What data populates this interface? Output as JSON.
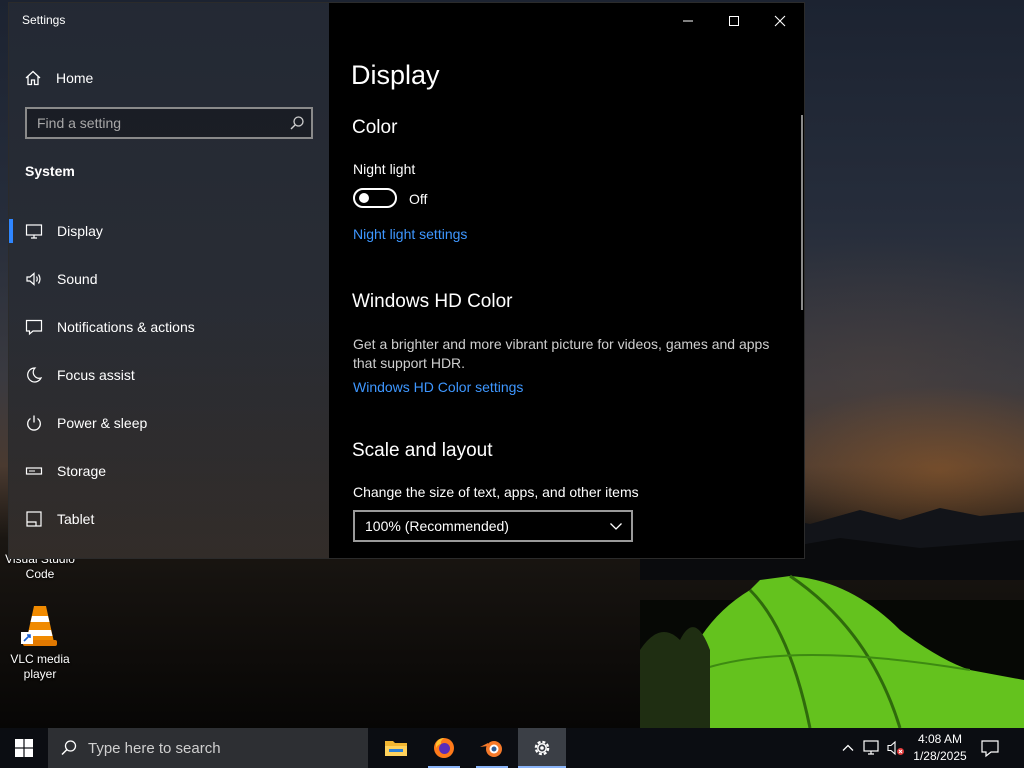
{
  "desktop": {
    "icons": [
      {
        "label": "Visual Studio Code",
        "icon": "vscode-icon"
      },
      {
        "label": "VLC media player",
        "icon": "vlc-cone-icon"
      }
    ]
  },
  "window": {
    "app_title": "Settings",
    "caption_buttons": [
      "minimize-icon",
      "maximize-icon",
      "close-icon"
    ]
  },
  "sidebar": {
    "home_label": "Home",
    "search_placeholder": "Find a setting",
    "section_heading": "System",
    "items": [
      {
        "label": "Display",
        "icon": "monitor-icon",
        "active": true
      },
      {
        "label": "Sound",
        "icon": "speaker-icon"
      },
      {
        "label": "Notifications & actions",
        "icon": "notification-icon"
      },
      {
        "label": "Focus assist",
        "icon": "moon-icon"
      },
      {
        "label": "Power & sleep",
        "icon": "power-icon"
      },
      {
        "label": "Storage",
        "icon": "storage-icon"
      },
      {
        "label": "Tablet",
        "icon": "tablet-icon"
      }
    ]
  },
  "content": {
    "page_title": "Display",
    "color": {
      "heading": "Color",
      "night_light_label": "Night light",
      "night_light_state": "Off",
      "night_light_on": false,
      "night_light_link": "Night light settings"
    },
    "hd_color": {
      "heading": "Windows HD Color",
      "description": "Get a brighter and more vibrant picture for videos, games and apps that support HDR.",
      "link": "Windows HD Color settings"
    },
    "scale": {
      "heading": "Scale and layout",
      "label": "Change the size of text, apps, and other items",
      "selected": "100% (Recommended)"
    }
  },
  "taskbar": {
    "search_placeholder": "Type here to search",
    "apps": [
      {
        "name": "file-explorer-icon",
        "running": false,
        "active": false
      },
      {
        "name": "firefox-icon",
        "running": true,
        "active": false
      },
      {
        "name": "blender-icon",
        "running": true,
        "active": false
      },
      {
        "name": "settings-gear-icon",
        "running": true,
        "active": true
      }
    ],
    "tray_icons": [
      "chevron-up-icon",
      "network-icon",
      "volume-muted-icon"
    ],
    "time": "4:08 AM",
    "date": "1/28/2025"
  },
  "colors": {
    "accent": "#2f86ff",
    "link": "#3e97ff",
    "window_bg": "#000000",
    "taskbar_bg": "#0b0d12"
  }
}
